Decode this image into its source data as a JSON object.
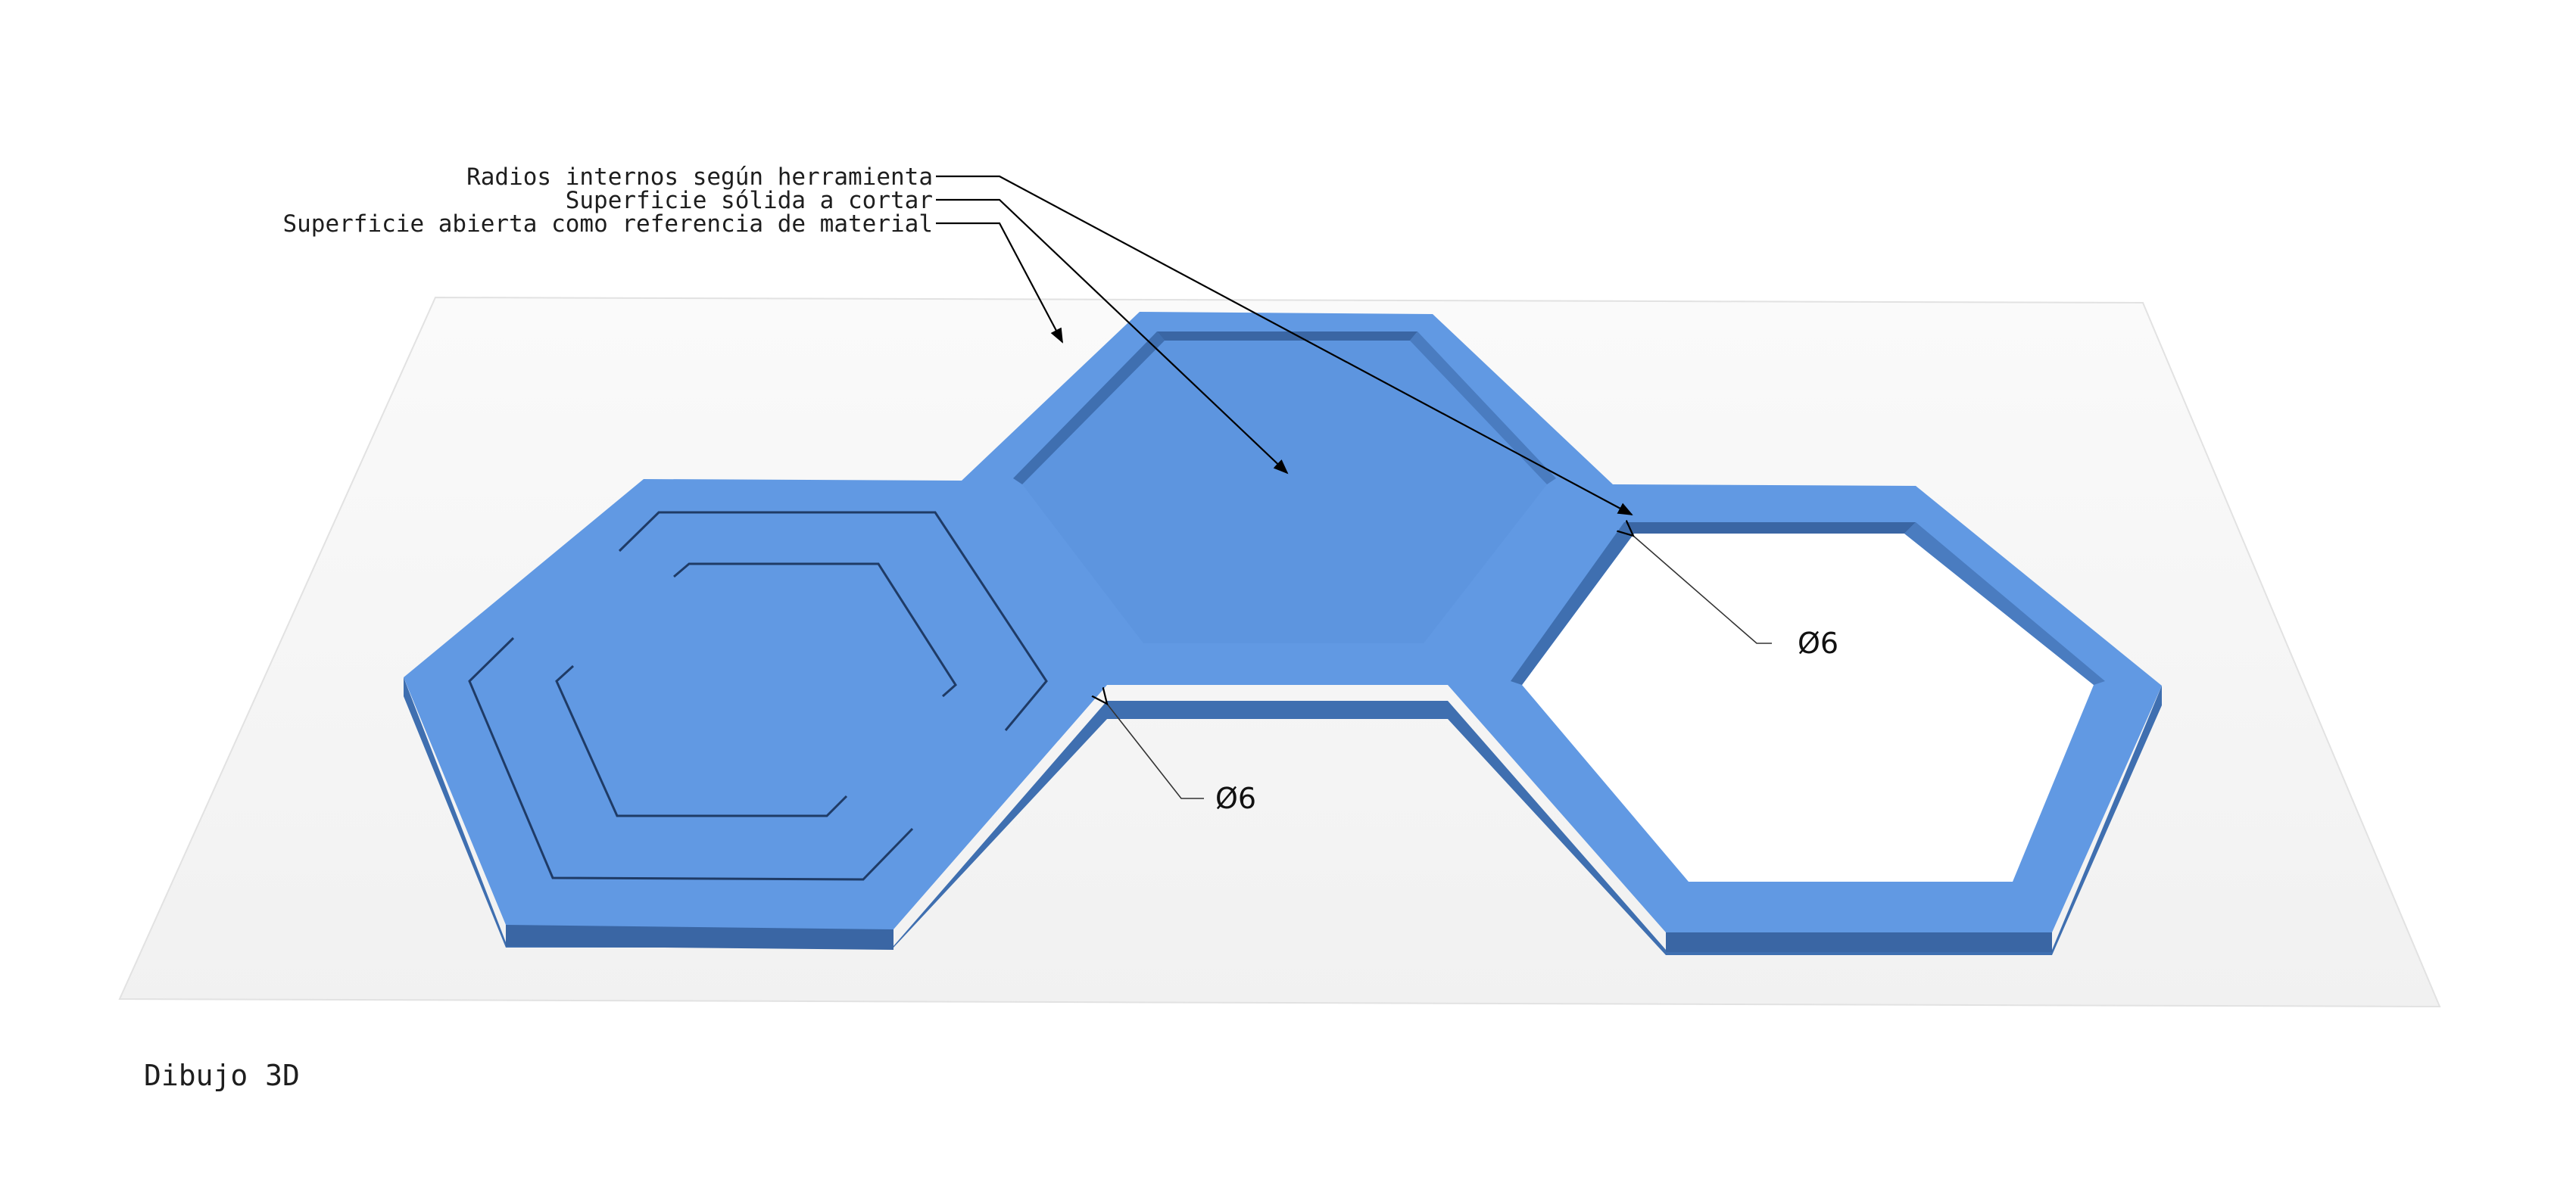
{
  "callouts": {
    "internal_radii": "Radios internos según herramienta",
    "solid_surface": "Superficie sólida a cortar",
    "open_surface": "Superficie abierta como referencia de material"
  },
  "dimensions": {
    "left_radius": "Ø6",
    "right_radius": "Ø6"
  },
  "view_label": "Dibujo 3D",
  "colors": {
    "part_top": "#6199e3",
    "part_side": "#4a7cc0",
    "part_shadow": "#3d69a6",
    "plate": "#f5f5f5",
    "leader": "#000000"
  }
}
